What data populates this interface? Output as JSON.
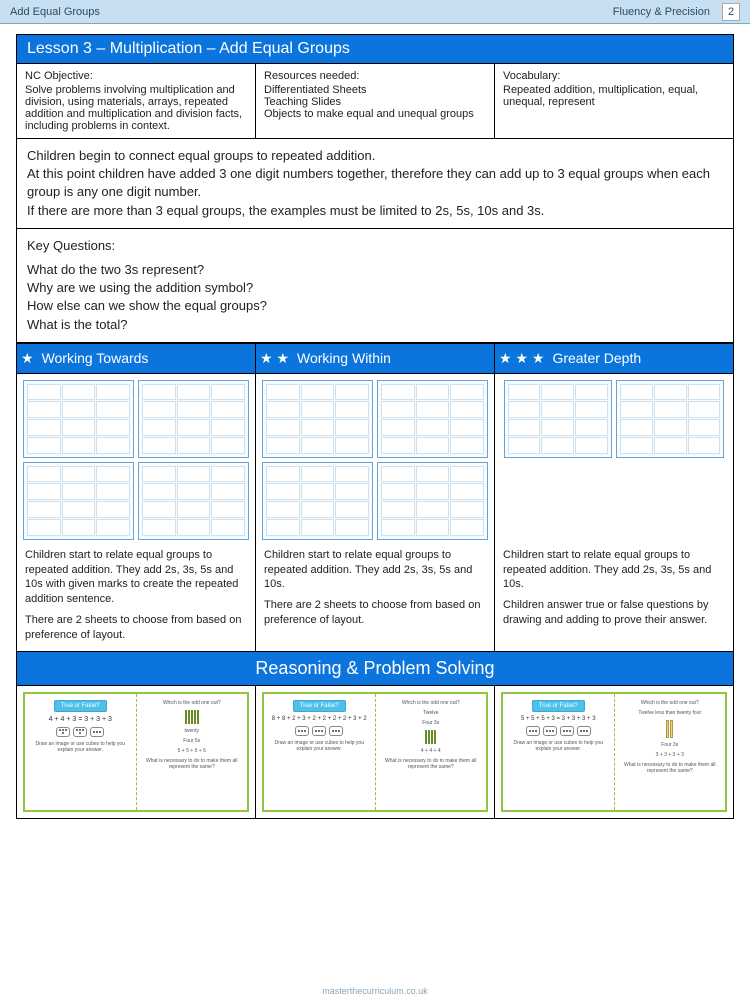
{
  "header": {
    "left": "Add Equal Groups",
    "right": "Fluency & Precision",
    "page_number": "2"
  },
  "lesson_banner": "Lesson 3 – Multiplication – Add Equal Groups",
  "grid": {
    "nc_head": "NC Objective:",
    "nc_body": "Solve problems involving multiplication and division, using materials, arrays, repeated addition and multiplication and division facts, including problems in context.",
    "res_head": "Resources needed:",
    "res_body": "Differentiated Sheets\nTeaching Slides\nObjects to make equal and unequal groups",
    "voc_head": "Vocabulary:",
    "voc_body": "Repeated addition, multiplication, equal, unequal, represent"
  },
  "intro": "Children begin to connect equal groups to repeated addition.\nAt this point children have added 3 one digit numbers together, therefore they can add up to 3 equal groups when each group is any one digit number.\nIf there are more than 3 equal groups, the examples must be limited to 2s, 5s, 10s and 3s.",
  "key_head": "Key Questions:",
  "key_q1": "What do the two 3s represent?",
  "key_q2": "Why are we using the addition symbol?",
  "key_q3": "How else can we show the equal groups?",
  "key_q4": "What is the total?",
  "levels": {
    "wt": "Working Towards",
    "ww": "Working Within",
    "gd": "Greater Depth"
  },
  "level_desc": {
    "wt1": "Children start to relate equal groups to repeated addition. They add 2s, 3s, 5s and 10s with given marks to create the repeated addition sentence.",
    "wt2": "There are 2 sheets to choose from based on preference of layout.",
    "ww1": "Children start to relate equal groups to repeated addition. They add 2s, 3s, 5s and 10s.",
    "ww2": "There are 2 sheets to choose from based on preference of layout.",
    "gd1": "Children start to relate equal groups to repeated addition. They add 2s, 3s, 5s and 10s.",
    "gd2": "Children answer true or false questions by drawing and adding to prove their answer."
  },
  "rps_banner": "Reasoning & Problem Solving",
  "rps": {
    "tf": "True or False?",
    "odd": "Which is the odd one out?",
    "draw": "Draw an image or use cubes to help you explain your answer.",
    "necessary": "What is necessary to do to make them all represent the same?",
    "c1_eq": "4 + 4 + 3 = 3 + 3 + 3",
    "c1_a1": "twenty",
    "c1_a2": "Four 5s",
    "c1_a3": "5 + 5 + 5 + 5",
    "c2_eq": "8 + 8 + 2 + 3 + 2 + 2 + 2 + 2 + 3 + 2",
    "c2_a1": "Twelve",
    "c2_a2": "Four 3s",
    "c2_a3": "4 + 4 + 4",
    "c3_eq": "5 + 5 + 5 + 3 = 3 + 3 + 3 + 3",
    "c3_a1": "Twelve less than twenty four",
    "c3_a2": "Four 3s",
    "c3_a3": "3 + 3 + 3 + 3"
  },
  "footer": "masterthecurriculum.co.uk"
}
